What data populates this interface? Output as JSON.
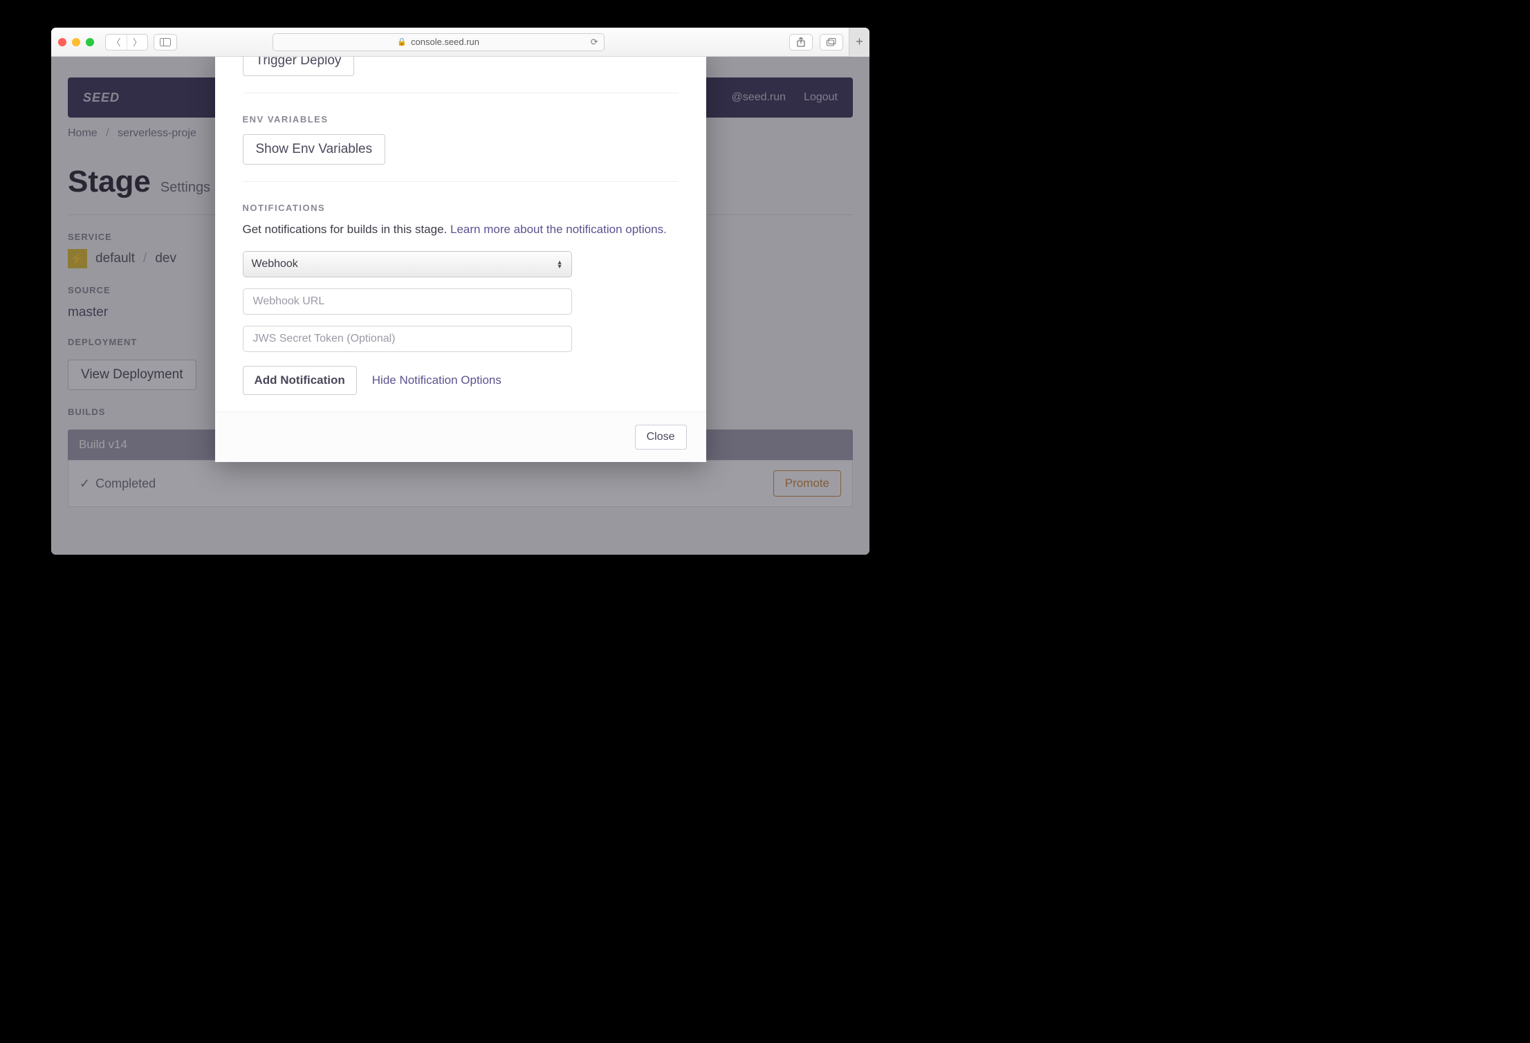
{
  "browser": {
    "url": "console.seed.run"
  },
  "header": {
    "logo": "SEED",
    "user": "@seed.run",
    "logout": "Logout"
  },
  "breadcrumb": {
    "home": "Home",
    "project": "serverless-proje"
  },
  "page": {
    "title": "Stage",
    "subtitle": "Settings"
  },
  "sections": {
    "service_label": "SERVICE",
    "service_name": "default",
    "service_stage": "dev",
    "source_label": "SOURCE",
    "source_value": "master",
    "deployment_label": "DEPLOYMENT",
    "view_deployment": "View Deployment",
    "builds_label": "BUILDS",
    "build_head": "Build v14",
    "completed": "Completed",
    "promote": "Promote"
  },
  "modal": {
    "trigger_deploy": "Trigger Deploy",
    "env_label": "ENV VARIABLES",
    "show_env": "Show Env Variables",
    "notif_label": "NOTIFICATIONS",
    "notif_text": "Get notifications for builds in this stage. ",
    "notif_link": "Learn more about the notification options.",
    "select_value": "Webhook",
    "url_placeholder": "Webhook URL",
    "token_placeholder": "JWS Secret Token (Optional)",
    "add_notification": "Add Notification",
    "hide_options": "Hide Notification Options",
    "close": "Close"
  }
}
